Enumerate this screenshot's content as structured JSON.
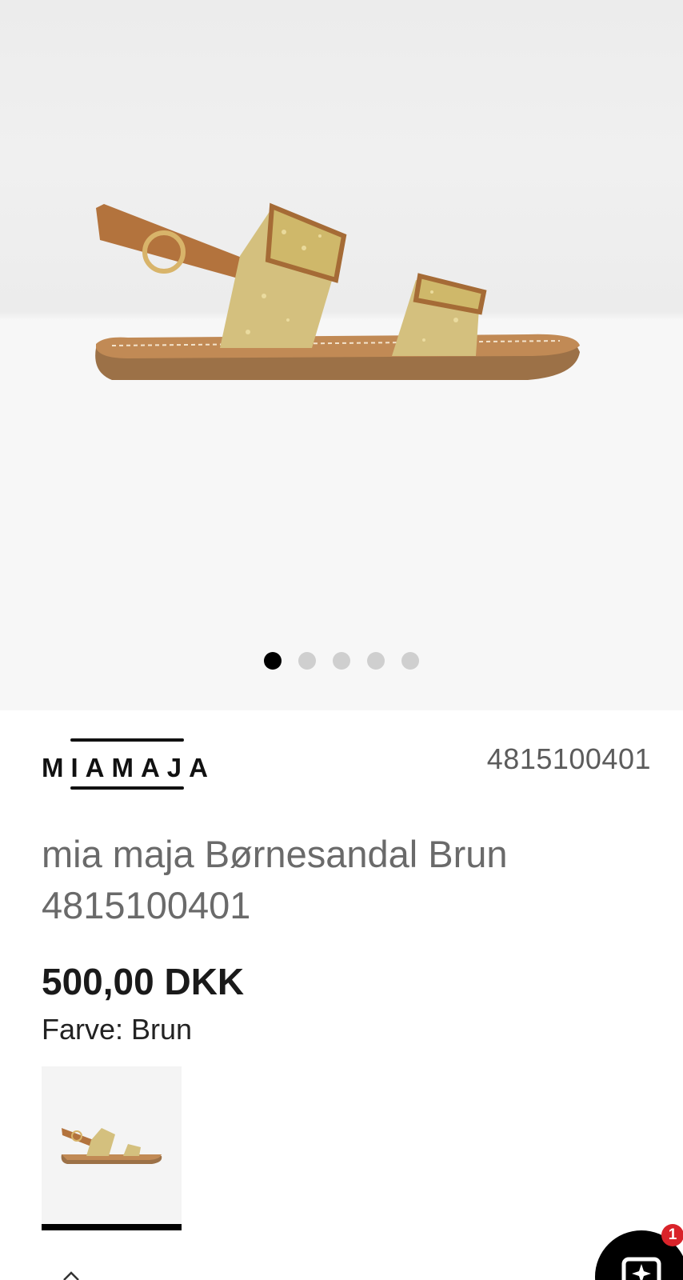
{
  "gallery": {
    "slide_count": 5,
    "active_slide": 1,
    "image_icon": "sandal-product-image"
  },
  "product": {
    "brand": "MIAMAJA",
    "sku": "4815100401",
    "title": "mia maja Børnesandal Brun 4815100401",
    "price": "500,00 DKK",
    "color_label": "Farve: Brun"
  },
  "swatches": [
    {
      "name": "Brun",
      "selected": true
    }
  ],
  "chat": {
    "badge_count": "1",
    "icon": "chat-sparkle-icon"
  },
  "colors": {
    "accent": "#000000",
    "badge": "#d9232a",
    "title_gray": "#6a6a6a"
  }
}
